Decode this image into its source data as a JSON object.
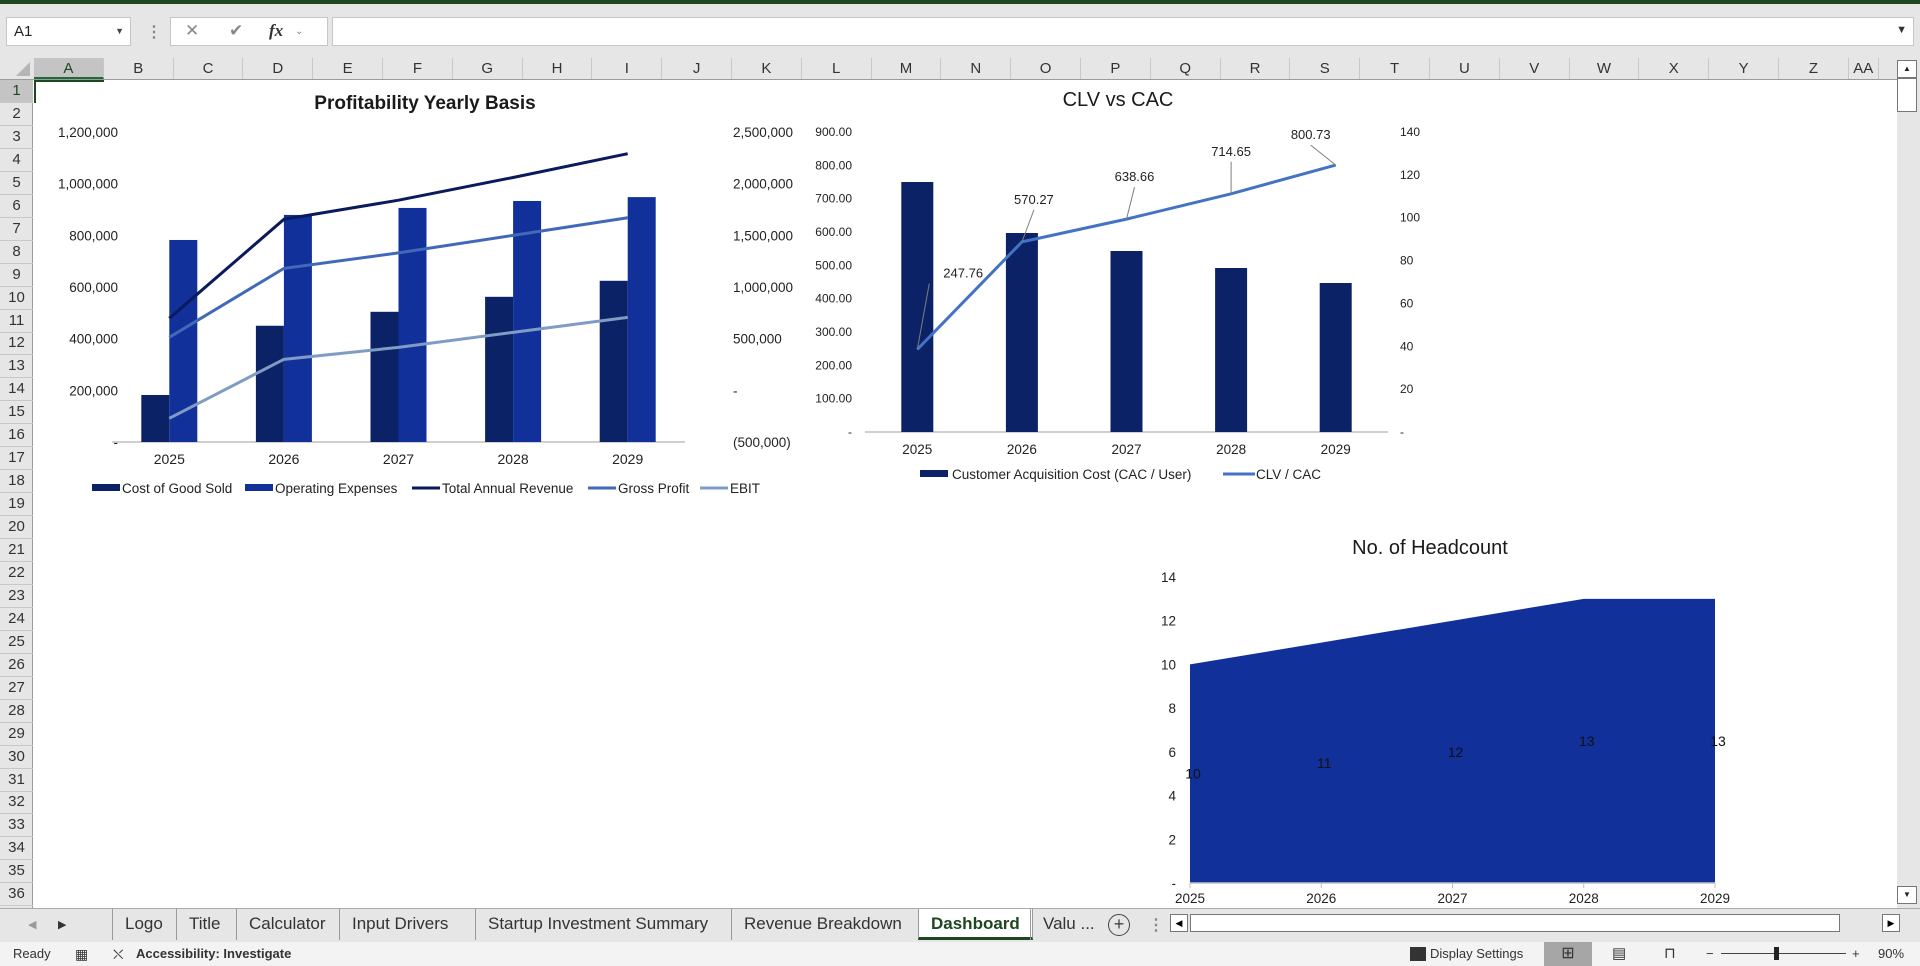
{
  "app": {
    "name_box": "A1",
    "formula_value": "",
    "formula_controls": {
      "cancel": "✕",
      "enter": "✔",
      "fx": "fx"
    },
    "columns": [
      "A",
      "B",
      "C",
      "D",
      "E",
      "F",
      "G",
      "H",
      "I",
      "J",
      "K",
      "L",
      "M",
      "N",
      "O",
      "P",
      "Q",
      "R",
      "S",
      "T",
      "U",
      "V",
      "W",
      "X",
      "Y",
      "Z",
      "AA"
    ],
    "rows": [
      "1",
      "2",
      "3",
      "4",
      "5",
      "6",
      "7",
      "8",
      "9",
      "10",
      "11",
      "12",
      "13",
      "14",
      "15",
      "16",
      "17",
      "18",
      "19",
      "20",
      "21",
      "22",
      "23",
      "24",
      "25",
      "26",
      "27",
      "28",
      "29",
      "30",
      "31",
      "32",
      "33",
      "34",
      "35",
      "36"
    ],
    "selected_cell": "A1"
  },
  "sheet_tabs": {
    "tabs": [
      "Logo",
      "Title",
      "Calculator",
      "Input Drivers",
      "Startup Investment Summary",
      "Revenue Breakdown",
      "Dashboard",
      "Valu ..."
    ],
    "active": "Dashboard"
  },
  "status_bar": {
    "mode": "Ready",
    "accessibility": "Accessibility: Investigate",
    "display_settings": "Display Settings",
    "zoom": "90%",
    "zoom_level": 0.9
  },
  "chart_data": [
    {
      "type": "bar",
      "title": "Profitability Yearly Basis",
      "categories": [
        "2025",
        "2026",
        "2027",
        "2028",
        "2029"
      ],
      "ylim": [
        0,
        1200000
      ],
      "y_ticks": [
        "-",
        "200,000",
        "400,000",
        "600,000",
        "800,000",
        "1,000,000",
        "1,200,000"
      ],
      "y2lim": [
        -500000,
        2500000
      ],
      "y2_ticks": [
        "(500,000)",
        "-",
        "500,000",
        "1,000,000",
        "1,500,000",
        "2,000,000",
        "2,500,000"
      ],
      "legend_position": "bottom",
      "series": [
        {
          "name": "Cost of Good Sold",
          "kind": "bar",
          "axis": "primary",
          "color": "#0b2266",
          "values": [
            182000,
            450000,
            504000,
            562000,
            624000
          ]
        },
        {
          "name": "Operating Expenses",
          "kind": "bar",
          "axis": "primary",
          "color": "#11309a",
          "values": [
            782000,
            879000,
            906000,
            933000,
            948000
          ]
        },
        {
          "name": "Total Annual Revenue",
          "kind": "line",
          "axis": "secondary",
          "color": "#0a1a5c",
          "values": [
            697000,
            1655000,
            1840000,
            2060000,
            2290000
          ]
        },
        {
          "name": "Gross Profit",
          "kind": "line",
          "axis": "secondary",
          "color": "#4169b8",
          "values": [
            513000,
            1180000,
            1330000,
            1500000,
            1670000
          ]
        },
        {
          "name": "EBIT",
          "kind": "line",
          "axis": "secondary",
          "color": "#7f9cc4",
          "values": [
            -271000,
            300000,
            416000,
            561000,
            706000
          ]
        }
      ]
    },
    {
      "type": "bar",
      "title": "CLV vs CAC",
      "categories": [
        "2025",
        "2026",
        "2027",
        "2028",
        "2029"
      ],
      "ylim": [
        0,
        900
      ],
      "y_ticks": [
        "-",
        "100.00",
        "200.00",
        "300.00",
        "400.00",
        "500.00",
        "600.00",
        "700.00",
        "800.00",
        "900.00"
      ],
      "y2lim": [
        0,
        140
      ],
      "y2_ticks": [
        "-",
        "20",
        "40",
        "60",
        "80",
        "100",
        "120",
        "140"
      ],
      "legend_position": "bottom",
      "series": [
        {
          "name": "Customer Acquisition  Cost (CAC / User)",
          "kind": "bar",
          "axis": "primary",
          "color": "#0b2266",
          "values": [
            750,
            597,
            543,
            492,
            447
          ]
        },
        {
          "name": "CLV / CAC",
          "kind": "line",
          "axis": "primary",
          "color": "#4472c4",
          "values": [
            247.76,
            570.27,
            638.66,
            714.65,
            800.73
          ],
          "labels": [
            "247.76",
            "570.27",
            "638.66",
            "714.65",
            "800.73"
          ]
        }
      ]
    },
    {
      "type": "area",
      "title": "No. of Headcount",
      "categories": [
        "2025",
        "2026",
        "2027",
        "2028",
        "2029"
      ],
      "ylim": [
        0,
        14
      ],
      "y_ticks": [
        "-",
        "2",
        "4",
        "6",
        "8",
        "10",
        "12",
        "14"
      ],
      "series": [
        {
          "name": "Headcount",
          "color": "#11309a",
          "values": [
            10,
            11,
            12,
            13,
            13
          ],
          "labels": [
            "10",
            "11",
            "12",
            "13",
            "13"
          ]
        }
      ]
    }
  ]
}
